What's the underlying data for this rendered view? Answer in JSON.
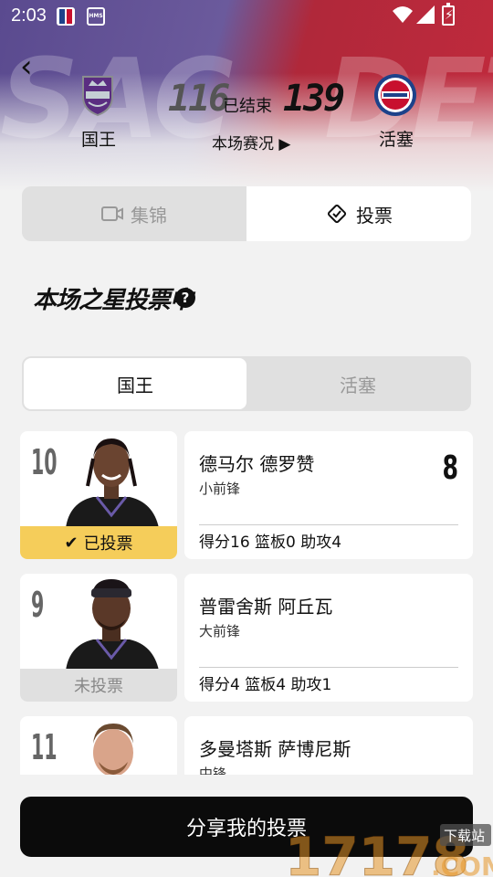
{
  "status_bar": {
    "time": "2:03",
    "hms_label": "HMS"
  },
  "header": {
    "bg_home_abbr": "SAC",
    "bg_away_abbr": "DET",
    "home_team": "国王",
    "away_team": "活塞",
    "home_score": "116",
    "away_score": "139",
    "game_status": "已结束",
    "game_detail": "本场赛况 ▶"
  },
  "tabs": {
    "highlights": "集锦",
    "vote": "投票"
  },
  "section": {
    "title": "本场之星投票中",
    "help": "?"
  },
  "team_toggle": {
    "home": "国王",
    "away": "活塞"
  },
  "players": [
    {
      "jersey": "10",
      "name": "德马尔 德罗赞",
      "position": "小前锋",
      "votes": "8",
      "stats": "得分16  篮板0  助攻4",
      "vote_status": "已投票"
    },
    {
      "jersey": "9",
      "name": "普雷舍斯 阿丘瓦",
      "position": "大前锋",
      "votes": "",
      "stats": "得分4  篮板4  助攻1",
      "vote_status": "未投票"
    },
    {
      "jersey": "11",
      "name": "多曼塔斯 萨博尼斯",
      "position": "中锋",
      "votes": "",
      "stats": "",
      "vote_status": ""
    }
  ],
  "share_button": "分享我的投票",
  "watermark": {
    "main": "17178",
    "badge": "下载站",
    "suffix": ".COM"
  },
  "colors": {
    "kings_purple": "#5a4a8f",
    "pistons_red": "#c12a3d",
    "voted_yellow": "#f5cd5a",
    "dark": "#0b0b0b"
  }
}
